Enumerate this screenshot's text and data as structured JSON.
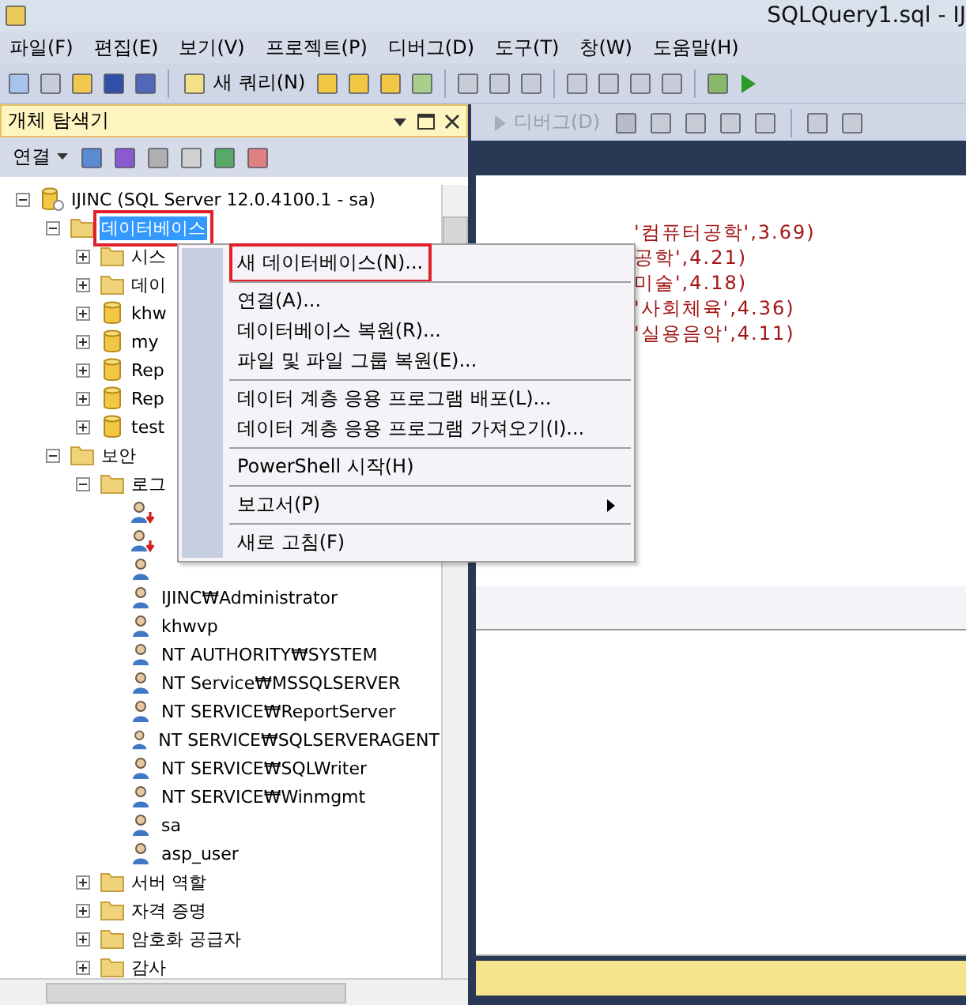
{
  "window": {
    "title": "SQLQuery1.sql - IJ"
  },
  "menu_bar": [
    "파일(F)",
    "편집(E)",
    "보기(V)",
    "프로젝트(P)",
    "디버그(D)",
    "도구(T)",
    "창(W)",
    "도움말(H)"
  ],
  "toolbar": {
    "new_query": "새 쿼리(N)"
  },
  "debug_toolbar": {
    "debug": {
      "label": "디버그(D)",
      "disabled": true
    }
  },
  "object_explorer": {
    "title": "개체 탐색기",
    "connect": "연결",
    "tree": [
      {
        "label": "IJINC (SQL Server 12.0.4100.1 - sa)",
        "kind": "server",
        "expanded": true,
        "selected": false,
        "children": [
          {
            "label": "데이터베이스",
            "kind": "folder",
            "expanded": true,
            "selected": true,
            "annotated": true,
            "children": [
              {
                "label": "시스",
                "kind": "folder",
                "expanded": false,
                "selected": false
              },
              {
                "label": "데이",
                "kind": "folder",
                "expanded": false,
                "selected": false
              },
              {
                "label": "khw",
                "kind": "database",
                "expanded": false,
                "selected": false
              },
              {
                "label": "my",
                "kind": "database",
                "expanded": false,
                "selected": false
              },
              {
                "label": "Rep",
                "kind": "database",
                "expanded": false,
                "selected": false
              },
              {
                "label": "Rep",
                "kind": "database",
                "expanded": false,
                "selected": false
              },
              {
                "label": "test",
                "kind": "database",
                "expanded": false,
                "selected": false
              }
            ]
          },
          {
            "label": "보안",
            "kind": "folder",
            "expanded": true,
            "selected": false,
            "children": [
              {
                "label": "로그",
                "kind": "folder",
                "expanded": true,
                "selected": false,
                "children": [
                  {
                    "kind": "login-disabled",
                    "selected": false
                  },
                  {
                    "kind": "login-disabled",
                    "selected": false
                  },
                  {
                    "kind": "login",
                    "selected": false
                  },
                  {
                    "label": "IJINC₩Administrator",
                    "kind": "login",
                    "selected": false
                  },
                  {
                    "label": "khwvp",
                    "kind": "login",
                    "selected": false
                  },
                  {
                    "label": "NT AUTHORITY₩SYSTEM",
                    "kind": "login",
                    "selected": false
                  },
                  {
                    "label": "NT Service₩MSSQLSERVER",
                    "kind": "login",
                    "selected": false
                  },
                  {
                    "label": "NT SERVICE₩ReportServer",
                    "kind": "login",
                    "selected": false
                  },
                  {
                    "label": "NT SERVICE₩SQLSERVERAGENT",
                    "kind": "login",
                    "selected": false
                  },
                  {
                    "label": "NT SERVICE₩SQLWriter",
                    "kind": "login",
                    "selected": false
                  },
                  {
                    "label": "NT SERVICE₩Winmgmt",
                    "kind": "login",
                    "selected": false
                  },
                  {
                    "label": "sa",
                    "kind": "login",
                    "selected": false
                  },
                  {
                    "label": "asp_user",
                    "kind": "login",
                    "selected": false
                  }
                ]
              },
              {
                "label": "서버 역할",
                "kind": "folder",
                "expanded": false,
                "selected": false
              },
              {
                "label": "자격 증명",
                "kind": "folder",
                "expanded": false,
                "selected": false
              },
              {
                "label": "암호화 공급자",
                "kind": "folder",
                "expanded": false,
                "selected": false
              },
              {
                "label": "감사",
                "kind": "folder",
                "expanded": false,
                "selected": false
              }
            ]
          }
        ]
      }
    ]
  },
  "editor": {
    "lines": [
      "'컴퓨터공학',3.69)",
      "공학',4.21)",
      "미술',4.18)",
      "'사회체육',4.36)",
      "'실용음악',4.11)"
    ]
  },
  "context_menu": [
    {
      "kind": "item",
      "label": "새 데이터베이스(N)...",
      "annotated": true
    },
    {
      "kind": "separator"
    },
    {
      "kind": "item",
      "label": "연결(A)..."
    },
    {
      "kind": "item",
      "label": "데이터베이스 복원(R)..."
    },
    {
      "kind": "item",
      "label": "파일 및 파일 그룹 복원(E)..."
    },
    {
      "kind": "separator"
    },
    {
      "kind": "item",
      "label": "데이터 계층 응용 프로그램 배포(L)..."
    },
    {
      "kind": "item",
      "label": "데이터 계층 응용 프로그램 가져오기(I)..."
    },
    {
      "kind": "separator"
    },
    {
      "kind": "item",
      "label": "PowerShell 시작(H)"
    },
    {
      "kind": "separator"
    },
    {
      "kind": "submenu",
      "label": "보고서(P)"
    },
    {
      "kind": "separator"
    },
    {
      "kind": "item",
      "label": "새로 고침(F)"
    }
  ]
}
